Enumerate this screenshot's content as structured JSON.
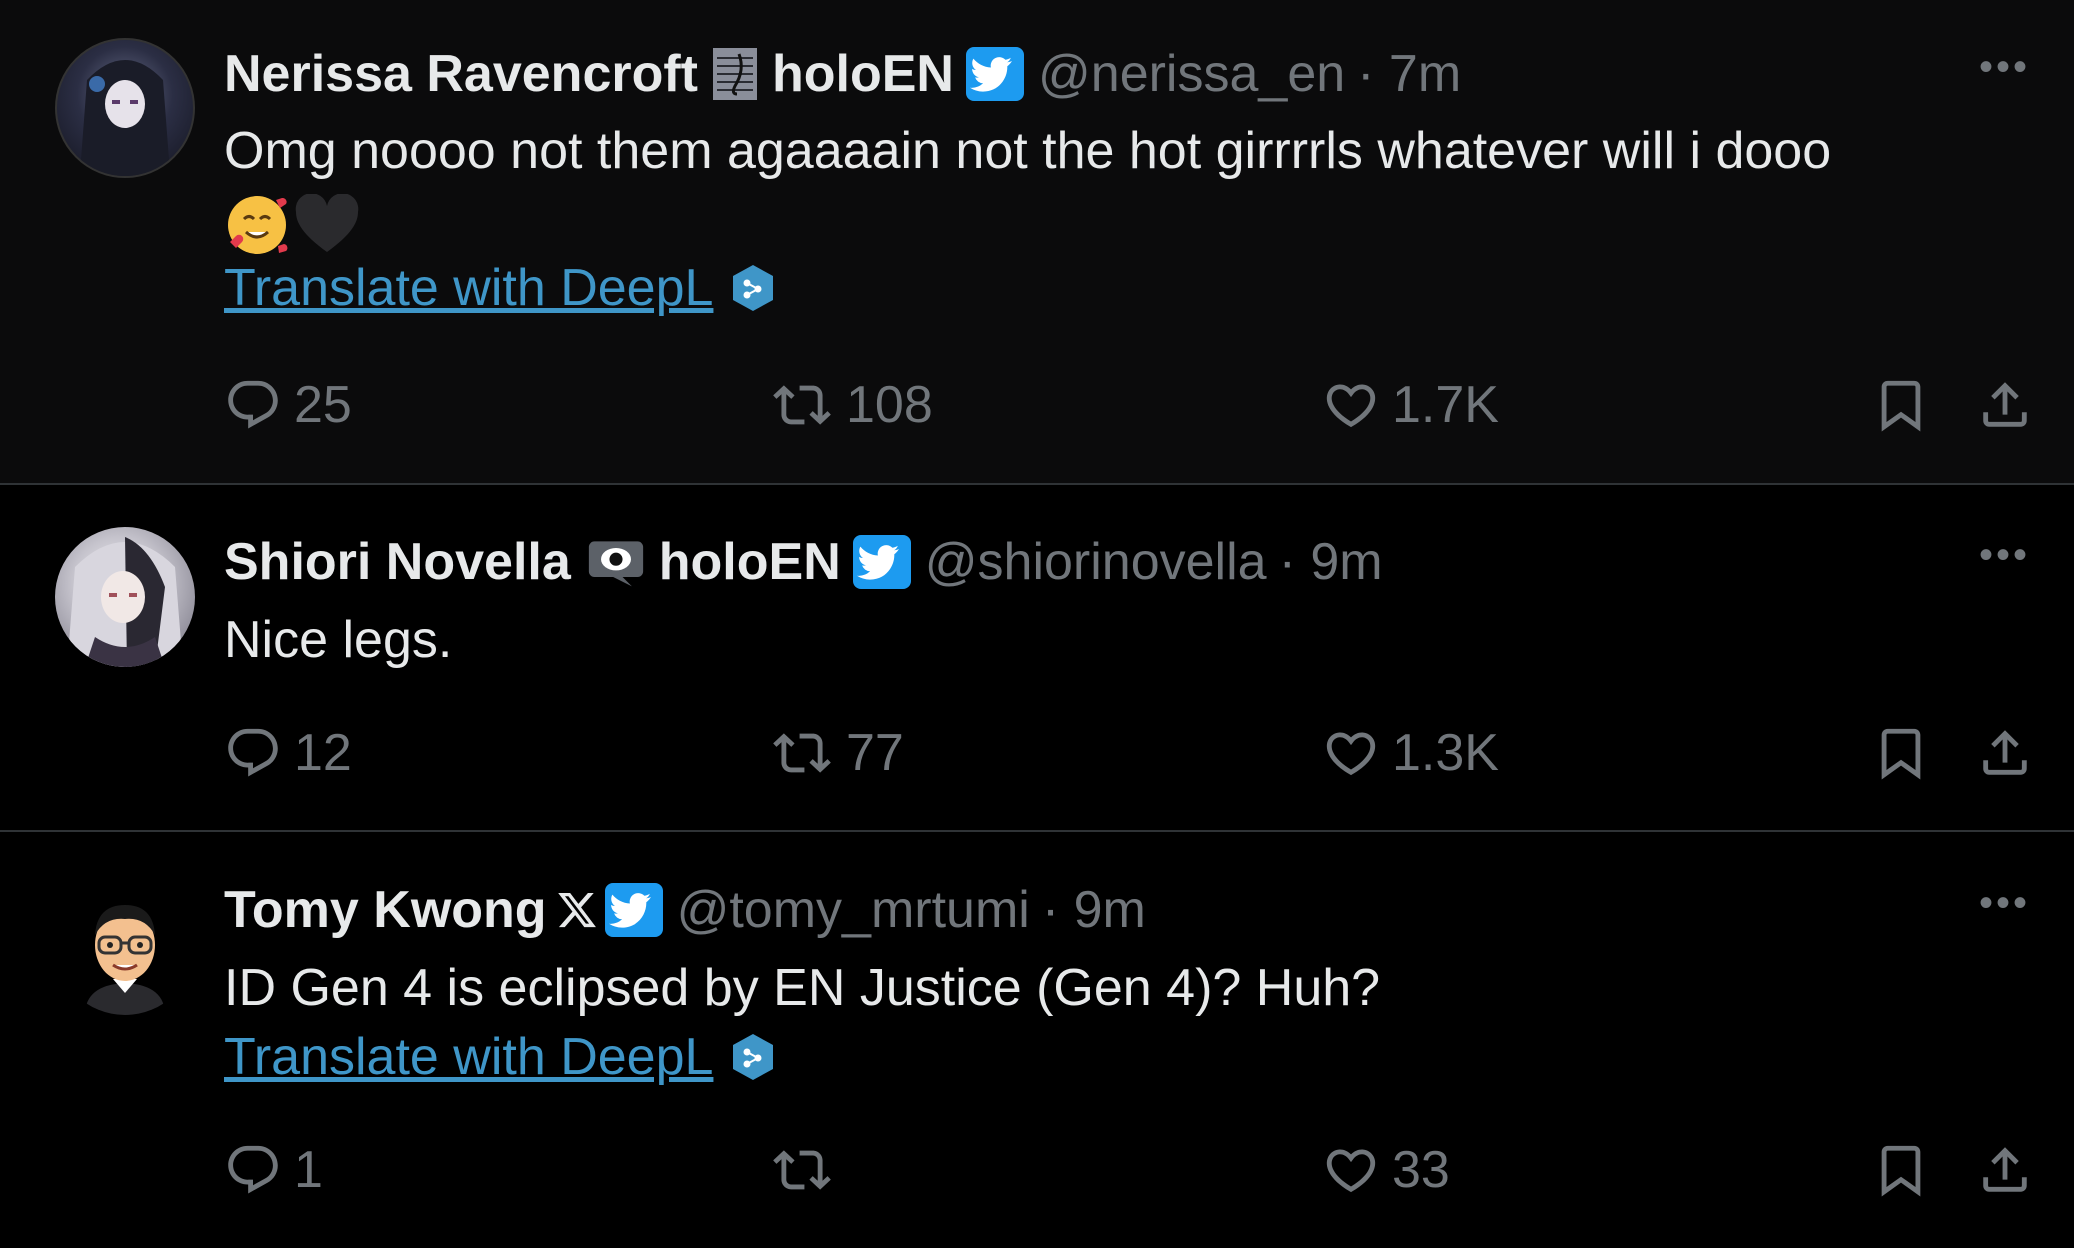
{
  "tweets": [
    {
      "name": "Nerissa Ravencroft",
      "affiliation": "holoEN",
      "handle": "@nerissa_en",
      "time": "· 7m",
      "text": "Omg noooo not them agaaaain not the hot girrrrls whatever will i dooo",
      "emojis": [
        "smiling-face-with-hearts-icon",
        "black-heart-icon"
      ],
      "translate_label": "Translate with DeepL",
      "replies": "25",
      "retweets": "108",
      "likes": "1.7K"
    },
    {
      "name": "Shiori Novella",
      "affiliation": "holoEN",
      "handle": "@shiorinovella",
      "time": "· 9m",
      "text": "Nice legs.",
      "replies": "12",
      "retweets": "77",
      "likes": "1.3K"
    },
    {
      "name": "Tomy Kwong",
      "handle": "@tomy_mrtumi",
      "time": "· 9m",
      "text": "ID Gen 4 is eclipsed by EN Justice (Gen 4)? Huh?",
      "translate_label": "Translate with DeepL",
      "replies": "1",
      "retweets": "",
      "likes": "33"
    }
  ],
  "more_label": "•••",
  "colors": {
    "background": "#000000",
    "text": "#e7e9ea",
    "muted": "#71767b",
    "link": "#3f96c8",
    "verified": "#1d9bf0",
    "divider": "#2f3336"
  }
}
